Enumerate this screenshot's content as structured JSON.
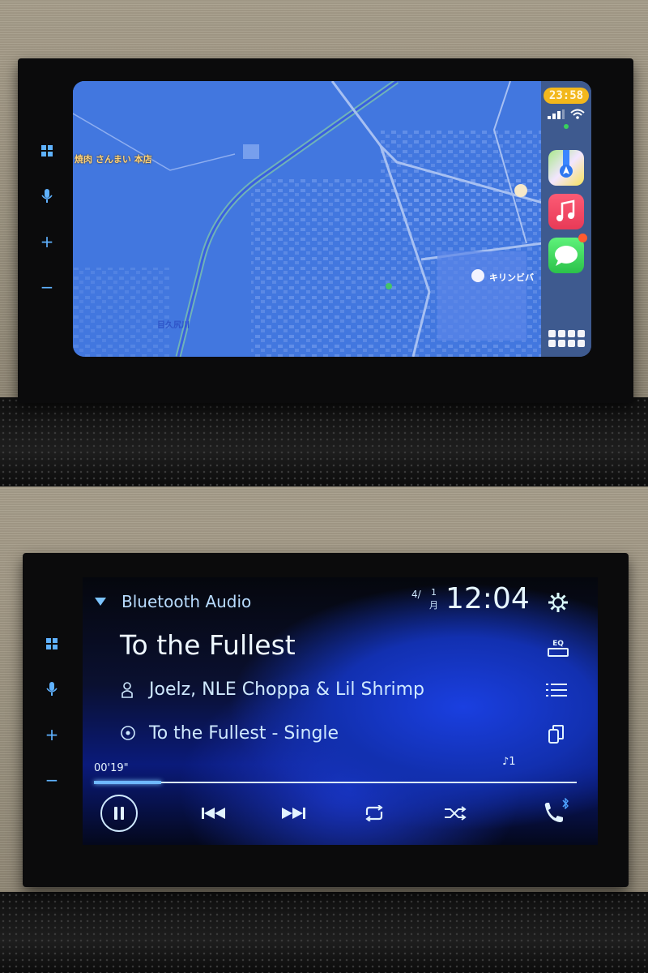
{
  "carplay": {
    "clock": "23:58",
    "map_labels": {
      "restaurant": "焼肉 さんまい 本店",
      "store": "キリンビバ",
      "river": "目久尻川"
    },
    "dock_apps": [
      {
        "name": "Maps",
        "icon": "maps-icon"
      },
      {
        "name": "Music",
        "icon": "music-icon"
      },
      {
        "name": "Messages",
        "icon": "messages-icon",
        "has_badge": true
      }
    ],
    "app_grid_icon": "app-grid-icon",
    "status": {
      "signal_bars": 3,
      "wifi": true
    }
  },
  "head_unit_buttons": [
    {
      "icon": "home-grid-icon",
      "symbol": "▦"
    },
    {
      "icon": "microphone-icon",
      "symbol": "🎤"
    },
    {
      "icon": "volume-up-icon",
      "symbol": "+"
    },
    {
      "icon": "volume-down-icon",
      "symbol": "−"
    }
  ],
  "audio": {
    "source": "Bluetooth Audio",
    "date_month": "4/",
    "date_day": "1",
    "date_weekday": "月",
    "clock": "12:04",
    "track_title": "To the Fullest",
    "artist": "Joelz, NLE Choppa & Lil Shrimp",
    "album": "To the Fullest - Single",
    "elapsed": "00'19\"",
    "track_number": "♪1",
    "progress_fraction": 0.14,
    "eq_label": "EQ",
    "colors": {
      "accent": "#6fb8ff",
      "text": "#cfe9ff"
    }
  }
}
